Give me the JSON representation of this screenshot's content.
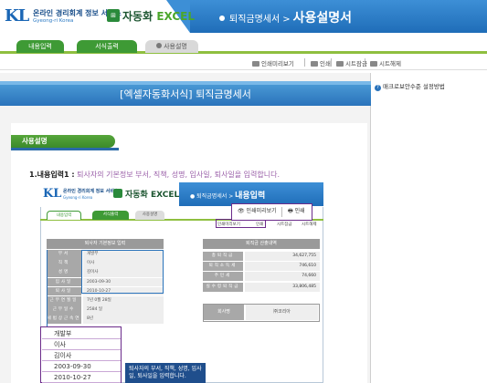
{
  "header": {
    "logo_kl": "KL",
    "logo_title": "온라인 경리회계 정보 서비스",
    "logo_sub": "Gyeong-ri Korea",
    "app_name_ko": "자동화",
    "app_name_en": "EXCEL",
    "breadcrumb_1": "퇴직금명세서",
    "breadcrumb_sep": ">",
    "breadcrumb_2": "사용설명서"
  },
  "tabs": [
    {
      "label": "내용입력"
    },
    {
      "label": "서식출력"
    },
    {
      "label": "사용설명"
    }
  ],
  "toolbar": {
    "preview": "인쇄미리보기",
    "print": "인쇄",
    "sheet_lock": "시트잠금",
    "sheet_unlock": "시트해제"
  },
  "main": {
    "title": "[엑셀자동화서식] 퇴직금명세서",
    "usage_tab": "사용설명",
    "step_label": "1.내용입력1 :",
    "step_desc": "퇴사자의 기본정보 부서, 직책, 성명, 입사일, 퇴사일을 입력합니다."
  },
  "sidebar": {
    "help_link": "매크로보안수준 설정방법"
  },
  "inner": {
    "logo_kl": "KL",
    "logo_title": "온라인 경리회계 정보 서비스",
    "logo_sub": "Gyeong-ri Korea",
    "app_name": "자동화 EXCEL",
    "breadcrumb_1": "퇴직금명세서",
    "breadcrumb_2": "내용입력",
    "tabs": [
      "내용입력",
      "서식출력",
      "사용설명"
    ],
    "toolbar": {
      "preview": "인쇄미리보기",
      "print": "인쇄",
      "sheet_lock": "시트잠금",
      "sheet_unlock": "시트해제"
    },
    "callout": {
      "preview": "인쇄미리보기",
      "print": "인쇄"
    },
    "left_table": {
      "title": "퇴사자 기본정보 입력",
      "rows": [
        {
          "k": "부서",
          "v": "개발부"
        },
        {
          "k": "직책",
          "v": "이사"
        },
        {
          "k": "성명",
          "v": "김이사"
        },
        {
          "k": "입사일",
          "v": "2003-09-30"
        },
        {
          "k": "퇴사일",
          "v": "2010-10-27"
        },
        {
          "k": "근무연월일",
          "v": "7년 0월 28일"
        },
        {
          "k": "근무일수",
          "v": "2584 일"
        },
        {
          "k": "세법상근속연수",
          "v": "8년"
        }
      ]
    },
    "right_table": {
      "title": "퇴직금 산출내역",
      "rows": [
        {
          "k": "총퇴직금",
          "v": "34,627,755"
        },
        {
          "k": "퇴직소득세",
          "v": "746,610"
        },
        {
          "k": "주민세",
          "v": "74,660"
        },
        {
          "k": "실수령퇴직금",
          "v": "33,806,485"
        }
      ],
      "company_label": "회사명",
      "company_value": "㈜코리아"
    },
    "dropdown_items": [
      "개발부",
      "이사",
      "김이사",
      "2003-09-30",
      "2010-10-27"
    ],
    "note": "퇴사자의 부서, 직책, 성명, 입사일, 퇴사일을 입력합니다."
  },
  "colors": {
    "brand_blue": "#2a73bb",
    "tab_green": "#3e9a35",
    "highlight_purple": "#6b2b8a"
  }
}
